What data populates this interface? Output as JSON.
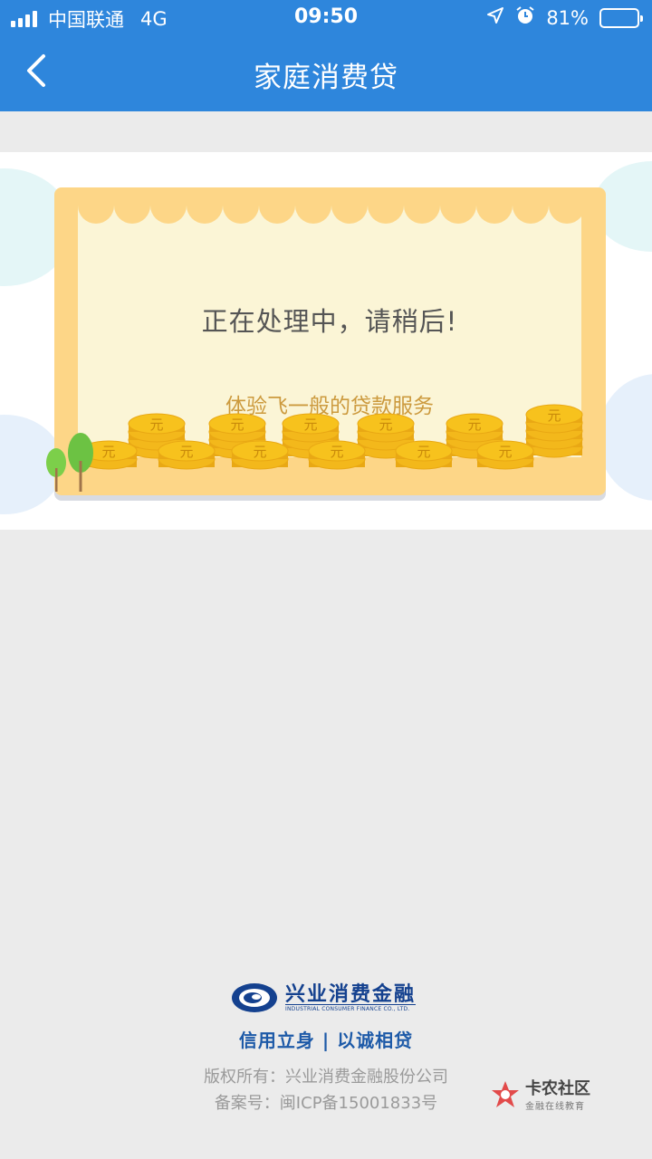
{
  "status_bar": {
    "carrier": "中国联通",
    "network": "4G",
    "time": "09:50",
    "battery": "81%",
    "battery_level": 0.81
  },
  "nav": {
    "title": "家庭消费贷",
    "back_icon": "chevron-left-icon"
  },
  "card": {
    "message": "正在处理中，请稍后!",
    "subtitle": "体验飞一般的贷款服务",
    "coin_symbol": "元"
  },
  "footer": {
    "logo_cn": "兴业消费金融",
    "logo_en": "INDUSTRIAL CONSUMER FINANCE CO., LTD.",
    "slogan": "信用立身 | 以诚相贷",
    "copyright": "版权所有：兴业消费金融股份公司",
    "icp": "备案号：闽ICP备15001833号"
  },
  "watermark": {
    "title": "卡农社区",
    "subtitle": "金融在线教育"
  },
  "colors": {
    "header_blue": "#2e86dc",
    "frame_yellow": "#fdd687",
    "coin_gold": "#f7c21d",
    "subtitle_text": "#cc9a3e",
    "brand_navy": "#14418f"
  }
}
